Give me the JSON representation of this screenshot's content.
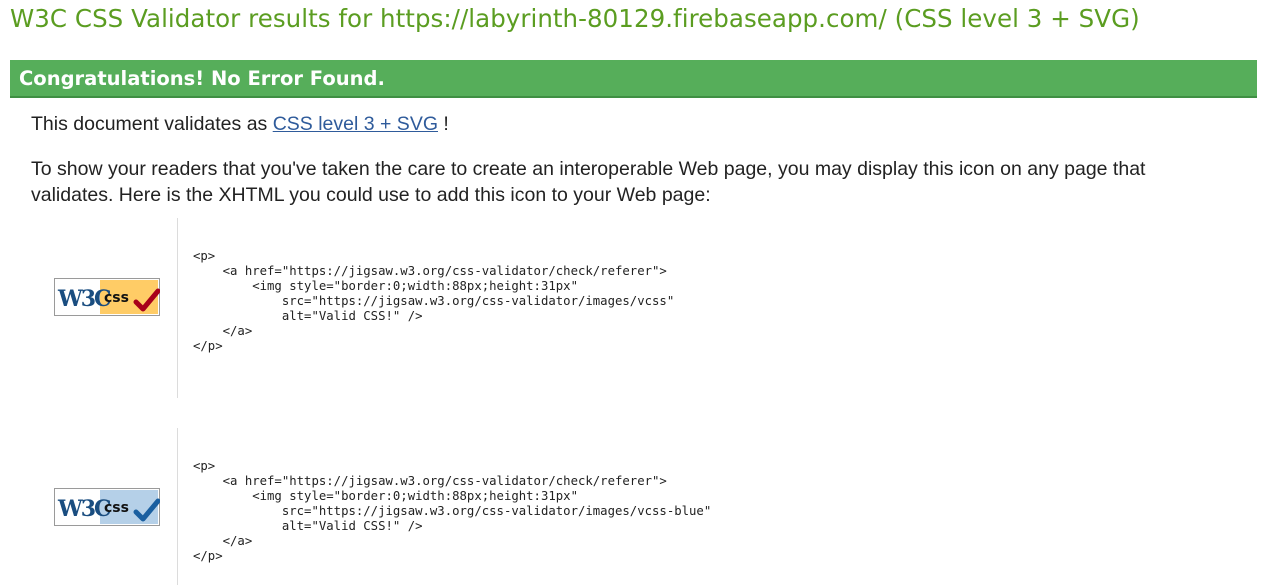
{
  "header": {
    "title": "W3C CSS Validator results for https://labyrinth-80129.firebaseapp.com/ (CSS level 3 + SVG)"
  },
  "result": {
    "heading": "Congratulations! No Error Found."
  },
  "validation_message": {
    "prefix": "This document validates as ",
    "link_label": "CSS level 3 + SVG",
    "suffix": " !"
  },
  "icon_message": "To show your readers that you've taken the care to create an interoperable Web page, you may display this icon on any page that validates. Here is the XHTML you could use to add this icon to your Web page:",
  "badges": [
    {
      "logo_text": "W3C",
      "label": "css",
      "variant": "gold",
      "accent_color": "#ffcc66",
      "check_color": "#a8001a",
      "code": "<p>\n    <a href=\"https://jigsaw.w3.org/css-validator/check/referer\">\n        <img style=\"border:0;width:88px;height:31px\"\n            src=\"https://jigsaw.w3.org/css-validator/images/vcss\"\n            alt=\"Valid CSS!\" />\n    </a>\n</p>"
    },
    {
      "logo_text": "W3C",
      "label": "css",
      "variant": "blue",
      "accent_color": "#b5d0e8",
      "check_color": "#1a5fa0",
      "code": "<p>\n    <a href=\"https://jigsaw.w3.org/css-validator/check/referer\">\n        <img style=\"border:0;width:88px;height:31px\"\n            src=\"https://jigsaw.w3.org/css-validator/images/vcss-blue\"\n            alt=\"Valid CSS!\" />\n    </a>\n</p>"
    }
  ],
  "colors": {
    "title": "#5b9d21",
    "success_bar": "#56ae5a",
    "link": "#2f5b9b"
  }
}
